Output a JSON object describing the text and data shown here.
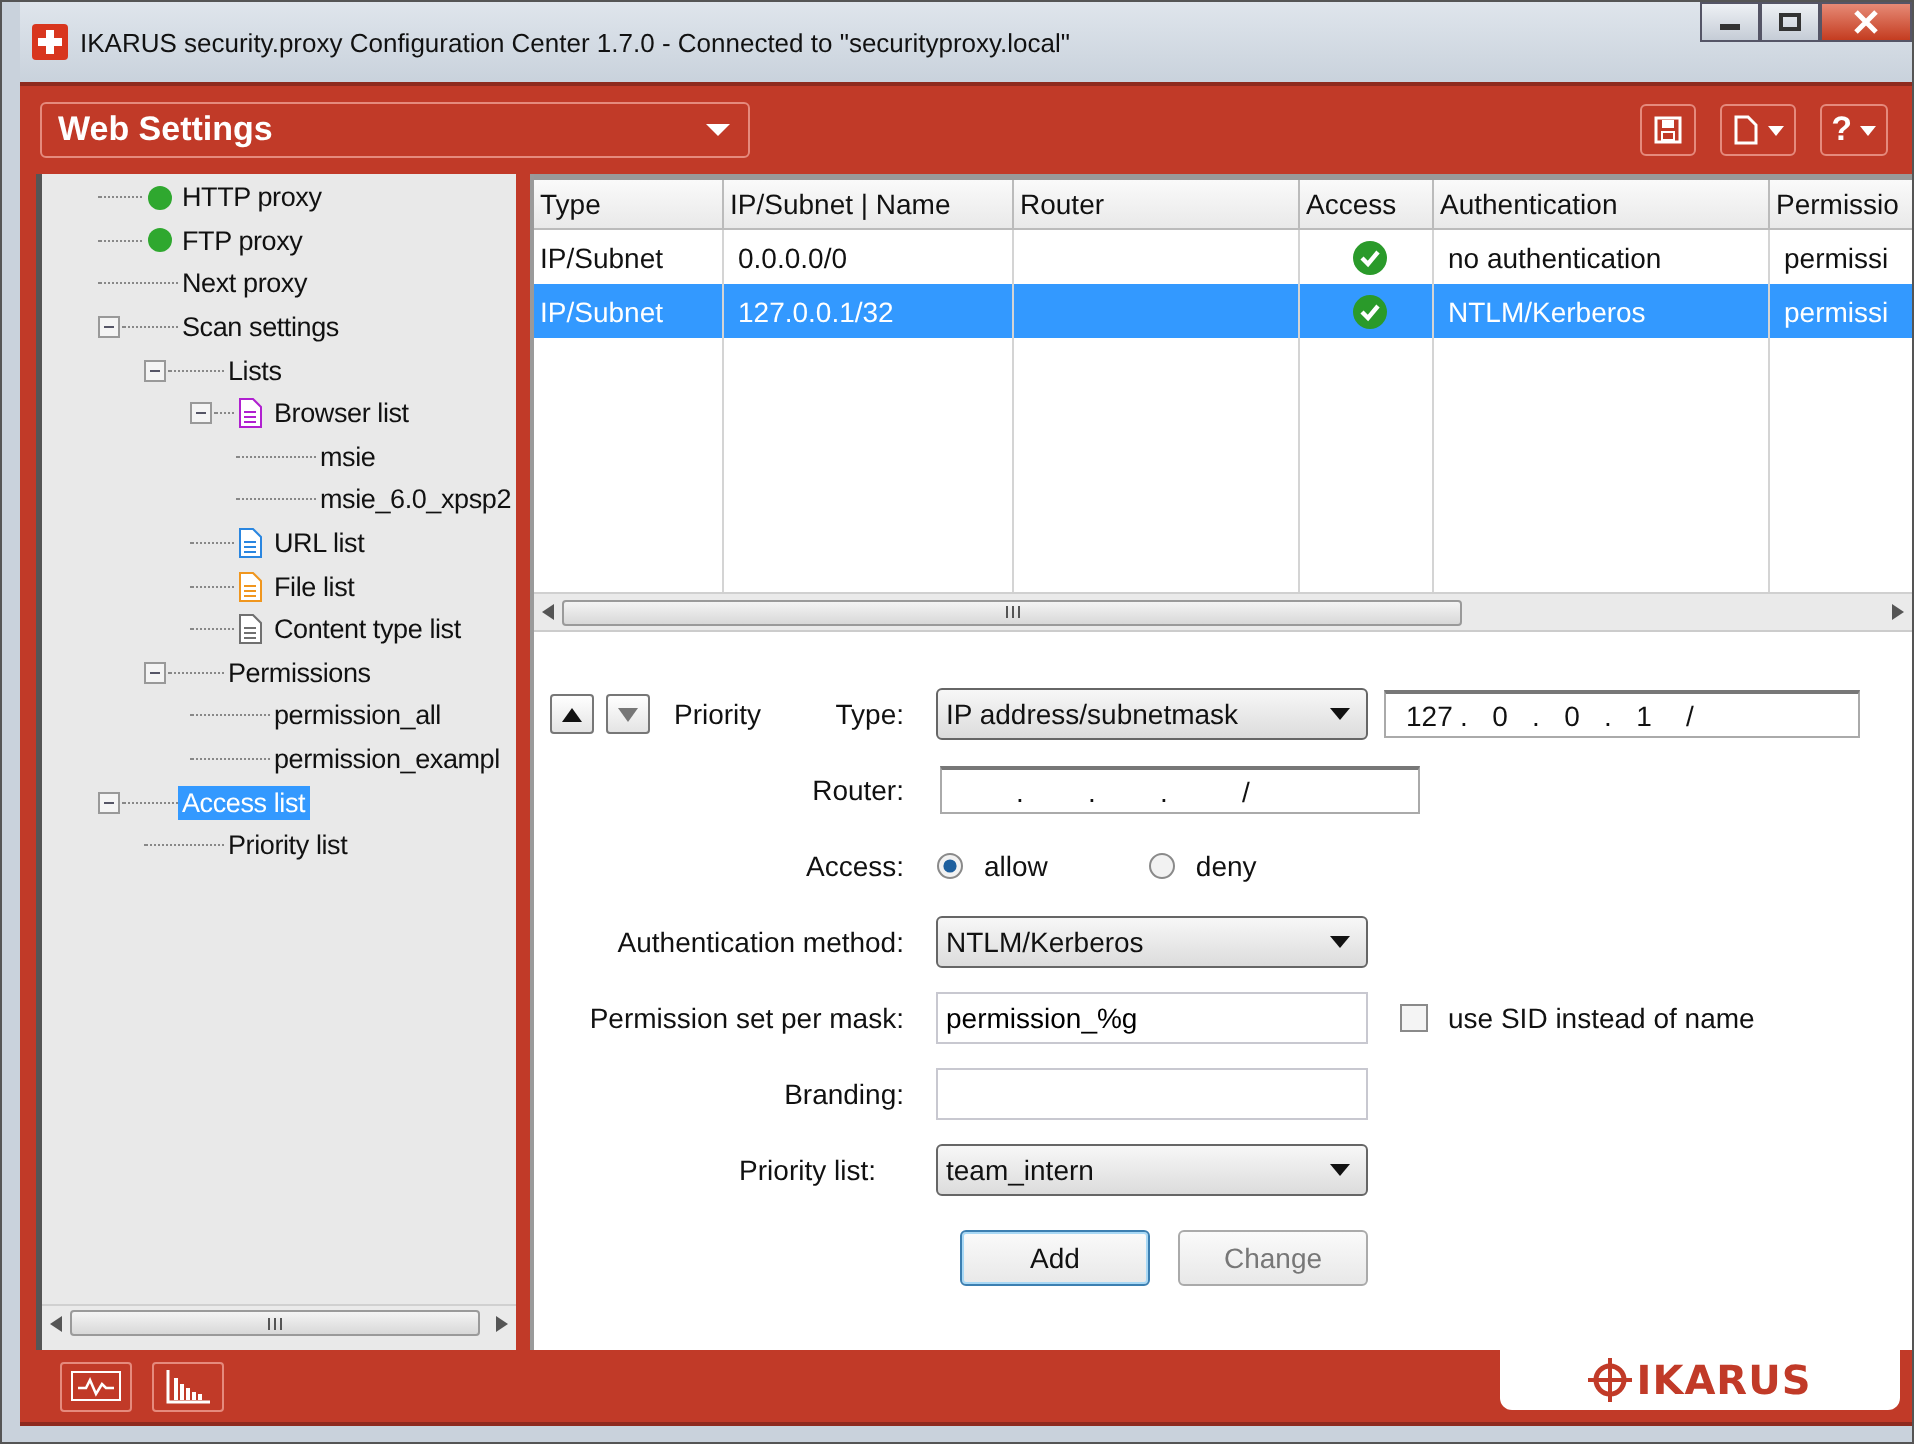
{
  "window": {
    "title": "IKARUS security.proxy Configuration Center  1.7.0 - Connected to \"securityproxy.local\""
  },
  "toolbar": {
    "view_select": "Web Settings",
    "help_label": "?"
  },
  "tree": [
    {
      "label": "HTTP proxy",
      "kind": "status",
      "color": "#2fa82f",
      "selected": false
    },
    {
      "label": "FTP proxy",
      "kind": "status",
      "color": "#2fa82f",
      "selected": false
    },
    {
      "label": "Next proxy",
      "selected": false
    },
    {
      "label": "Scan settings",
      "selected": false,
      "expanded": true,
      "children": [
        {
          "label": "Lists",
          "selected": false,
          "expanded": true,
          "children": [
            {
              "label": "Browser list",
              "kind": "document",
              "color": "#b020d0",
              "selected": false,
              "expanded": true,
              "children": [
                {
                  "label": "msie",
                  "selected": false
                },
                {
                  "label": "msie_6.0_xpsp2",
                  "selected": false
                }
              ]
            },
            {
              "label": "URL list",
              "kind": "document",
              "color": "#2a86e0",
              "selected": false
            },
            {
              "label": "File list",
              "kind": "document",
              "color": "#f0961e",
              "selected": false
            },
            {
              "label": "Content type list",
              "kind": "document",
              "color": "#707070",
              "selected": false
            }
          ]
        },
        {
          "label": "Permissions",
          "selected": false,
          "expanded": true,
          "children": [
            {
              "label": "permission_all",
              "selected": false
            },
            {
              "label": "permission_exampl",
              "selected": false
            }
          ]
        }
      ]
    },
    {
      "label": "Access list",
      "selected": true,
      "expanded": true,
      "children": [
        {
          "label": "Priority list",
          "selected": false
        }
      ]
    }
  ],
  "table": {
    "columns": [
      "Type",
      "IP/Subnet | Name",
      "Router",
      "Access",
      "Authentication",
      "Permissio"
    ],
    "rows": [
      {
        "type": "IP/Subnet",
        "ip": "0.0.0.0/0",
        "access": true,
        "authentication": "no authentication",
        "permission": "permissi",
        "selected": false
      },
      {
        "type": "IP/Subnet",
        "ip": "127.0.0.1/32",
        "access": true,
        "authentication": "NTLM/Kerberos",
        "permission": "permissi",
        "selected": true
      }
    ]
  },
  "form": {
    "priority_label": "Priority",
    "type": {
      "label": "Type:",
      "value": "IP address/subnetmask"
    },
    "ip": {
      "parts": [
        "127",
        "0",
        "0",
        "1"
      ],
      "dots": [
        ".",
        ".",
        "."
      ],
      "slash": "/"
    },
    "router": {
      "label": "Router:",
      "dots": [
        ".",
        ".",
        "."
      ],
      "slash": "/"
    },
    "access": {
      "label": "Access:",
      "options": [
        {
          "label": "allow",
          "selected": true
        },
        {
          "label": "deny",
          "selected": false
        }
      ]
    },
    "authentication": {
      "label": "Authentication method:",
      "value": "NTLM/Kerberos"
    },
    "permission": {
      "label": "Permission set per mask:",
      "value": "permission_%g"
    },
    "use_sid": {
      "label": "use SID instead of name",
      "checked": false
    },
    "branding": {
      "label": "Branding:"
    },
    "priority_list": {
      "label": "Priority list:",
      "value": "team_intern"
    },
    "buttons": [
      {
        "label": "Add",
        "disabled": false,
        "default": true
      },
      {
        "label": "Change",
        "disabled": true,
        "default": false
      }
    ]
  },
  "footer": {
    "logo": "IKARUS"
  }
}
